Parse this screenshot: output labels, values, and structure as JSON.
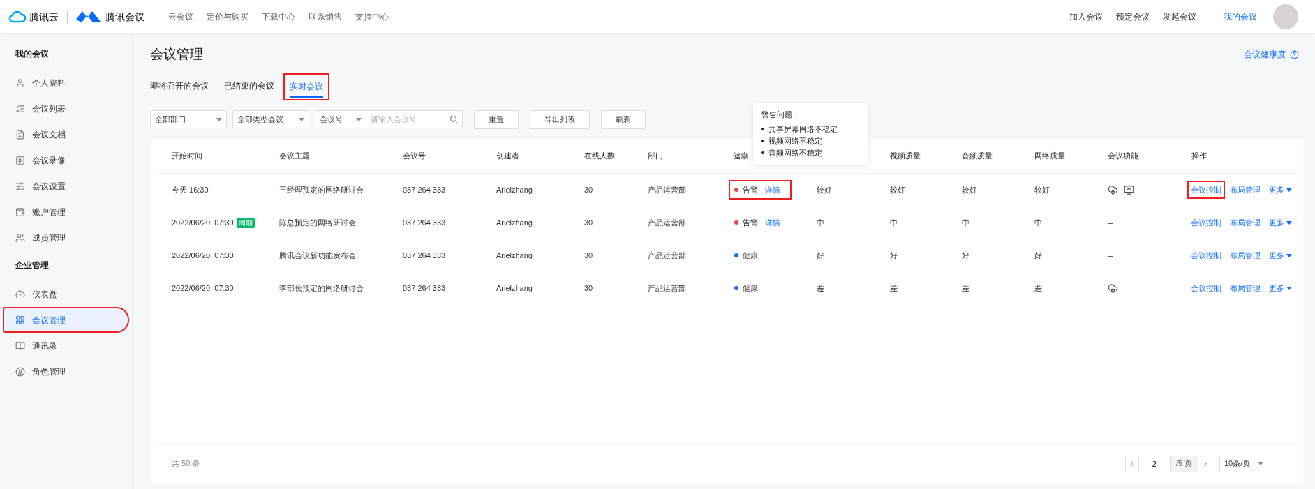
{
  "header": {
    "brand": "腾讯云",
    "product": "腾讯会议",
    "nav": [
      "云会议",
      "定价与购买",
      "下载中心",
      "联系销售",
      "支持中心"
    ],
    "actions": [
      {
        "label": "加入会议",
        "selected": false
      },
      {
        "label": "预定会议",
        "selected": false
      },
      {
        "label": "发起会议",
        "selected": false
      },
      {
        "label": "我的会议",
        "selected": true
      }
    ]
  },
  "sidebar": {
    "sections": [
      {
        "title": "我的会议",
        "items": [
          {
            "kind": "user",
            "label": "个人资料",
            "selected": false,
            "highlighted": false
          },
          {
            "kind": "list",
            "label": "会议列表",
            "selected": false,
            "highlighted": false
          },
          {
            "kind": "doc",
            "label": "会议文档",
            "selected": false,
            "highlighted": false
          },
          {
            "kind": "video",
            "label": "会议录像",
            "selected": false,
            "highlighted": false
          },
          {
            "kind": "settings",
            "label": "会议设置",
            "selected": false,
            "highlighted": false
          },
          {
            "kind": "account",
            "label": "账户管理",
            "selected": false,
            "highlighted": false
          },
          {
            "kind": "members",
            "label": "成员管理",
            "selected": false,
            "highlighted": false
          }
        ]
      },
      {
        "title": "企业管理",
        "items": [
          {
            "kind": "dashboard",
            "label": "仪表盘",
            "selected": false,
            "highlighted": false
          },
          {
            "kind": "grid",
            "label": "会议管理",
            "selected": true,
            "highlighted": true
          },
          {
            "kind": "contacts",
            "label": "通讯录",
            "selected": false,
            "highlighted": false
          },
          {
            "kind": "role",
            "label": "角色管理",
            "selected": false,
            "highlighted": false
          }
        ]
      }
    ]
  },
  "page": {
    "title": "会议管理",
    "health_link": "会议健康度",
    "tabs": [
      {
        "label": "即将召开的会议",
        "selected": false,
        "highlighted": false
      },
      {
        "label": "已结束的会议",
        "selected": false,
        "highlighted": false
      },
      {
        "label": "实时会议",
        "selected": true,
        "highlighted": true
      }
    ],
    "filters": {
      "department": "全部部门",
      "type": "全部类型会议",
      "search_by": "会议号",
      "search_placeholder": "请输入会议号",
      "buttons": [
        "重置",
        "导出列表",
        "刷新"
      ]
    },
    "tooltip": {
      "title": "警告问题：",
      "items": [
        "共享屏幕网络不稳定",
        "视频网络不稳定",
        "音频网络不稳定"
      ]
    },
    "table": {
      "columns": [
        "开始时间",
        "会议主题",
        "会议号",
        "创建者",
        "在线人数",
        "部门",
        "健康",
        "视频质量",
        "音频质量",
        "网络质量",
        "会议功能",
        "操作"
      ],
      "rows": [
        {
          "start": "今天 16:30",
          "subject": "王经理预定的网络研讨会",
          "number": "037 264 333",
          "creator": "Arielzhang",
          "online": "30",
          "dept": "产品运营部",
          "health": {
            "label": "告警",
            "color": "#f5413d",
            "detail": "详情",
            "highlighted": true
          },
          "quality": [
            "较好",
            "较好",
            "较好",
            "较好"
          ],
          "features": [
            {
              "kind": "cloud"
            },
            {
              "kind": "share"
            }
          ],
          "actions": [
            {
              "label": "会议控制",
              "highlighted": true
            },
            {
              "label": "布局管理",
              "highlighted": false
            },
            {
              "label": "更多",
              "highlighted": false
            }
          ]
        },
        {
          "start": "2022/06/20  07:30",
          "tag": "周期",
          "subject": "陈总预定的网络研讨会",
          "number": "037 264 333",
          "creator": "Arielzhang",
          "online": "30",
          "dept": "产品运营部",
          "health": {
            "label": "告警",
            "color": "#f5413d",
            "detail": "详情",
            "highlighted": false
          },
          "quality": [
            "中",
            "中",
            "中",
            "中"
          ],
          "features_text": "--",
          "actions": [
            {
              "label": "会议控制",
              "highlighted": false
            },
            {
              "label": "布局管理",
              "highlighted": false
            },
            {
              "label": "更多",
              "highlighted": false
            }
          ]
        },
        {
          "start": "2022/06/20  07:30",
          "subject": "腾讯会议新功能发布会",
          "number": "037 264 333",
          "creator": "Arielzhang",
          "online": "30",
          "dept": "产品运营部",
          "health": {
            "label": "健康",
            "color": "#0a6cff",
            "highlighted": false
          },
          "quality": [
            "好",
            "好",
            "好",
            "好"
          ],
          "features_text": "--",
          "actions": [
            {
              "label": "会议控制",
              "highlighted": false
            },
            {
              "label": "布局管理",
              "highlighted": false
            },
            {
              "label": "更多",
              "highlighted": false
            }
          ]
        },
        {
          "start": "2022/06/20  07:30",
          "subject": "李部长预定的网络研讨会",
          "number": "037 264 333",
          "creator": "Arielzhang",
          "online": "30",
          "dept": "产品运营部",
          "health": {
            "label": "健康",
            "color": "#0a6cff",
            "highlighted": false
          },
          "quality": [
            "差",
            "差",
            "差",
            "差"
          ],
          "features": [
            {
              "kind": "cloud"
            }
          ],
          "actions": [
            {
              "label": "会议控制",
              "highlighted": false
            },
            {
              "label": "布局管理",
              "highlighted": false
            },
            {
              "label": "更多",
              "highlighted": false
            }
          ]
        }
      ]
    },
    "footer": {
      "total": "共 50 条",
      "page": "2",
      "pages": "/5 页",
      "page_size": "10条/页"
    }
  }
}
